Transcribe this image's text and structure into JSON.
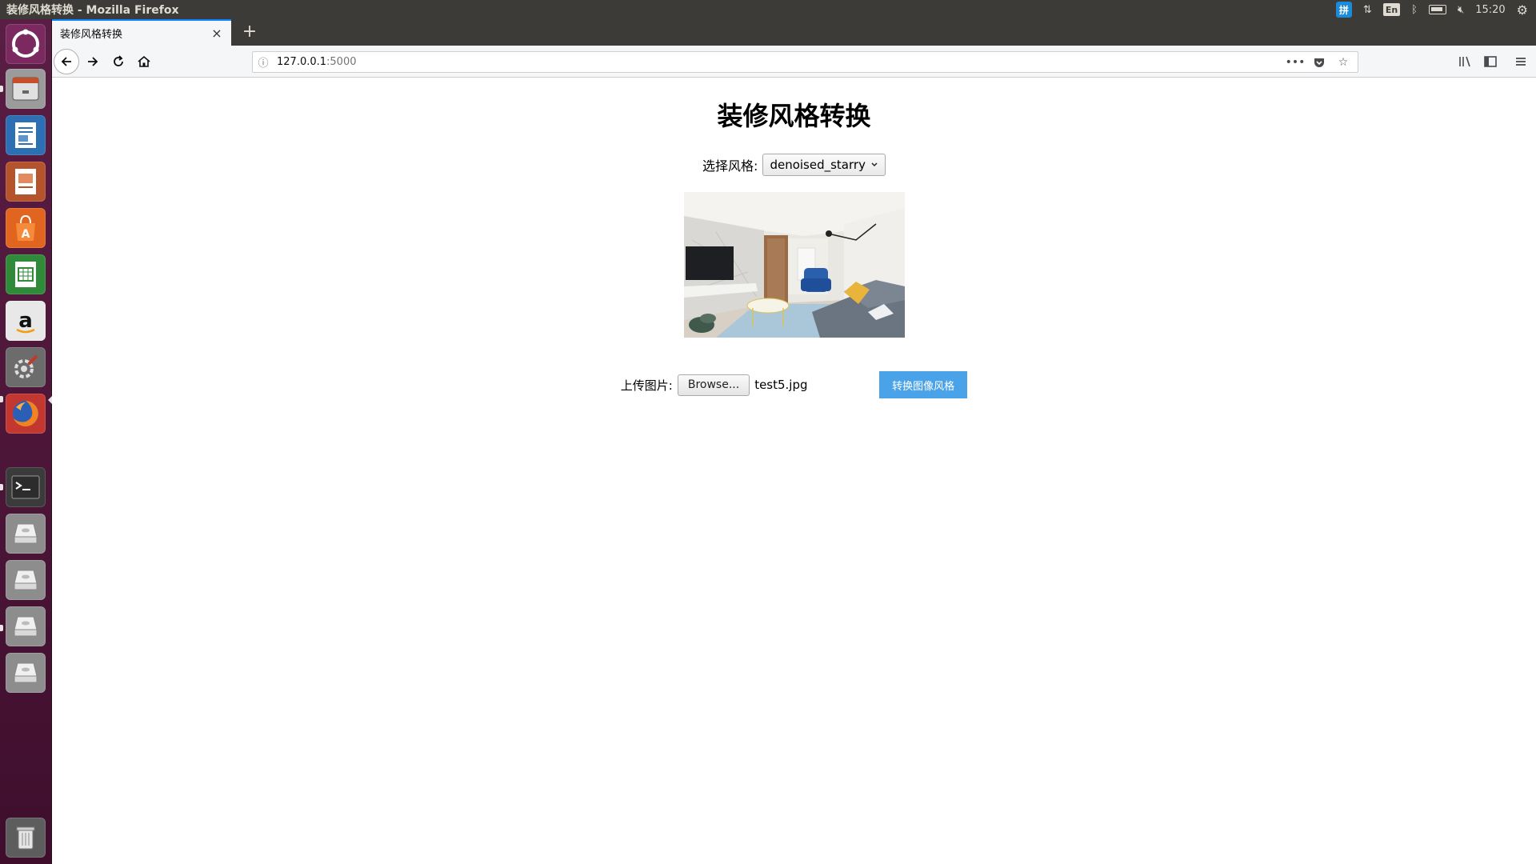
{
  "window": {
    "title": "装修风格转换 - Mozilla Firefox"
  },
  "tray": {
    "keyboard_label": "拼",
    "lang": "En",
    "time": "15:20"
  },
  "launcher": {
    "items": [
      {
        "name": "ubuntu-dash"
      },
      {
        "name": "files"
      },
      {
        "name": "libreoffice-writer"
      },
      {
        "name": "libreoffice-impress"
      },
      {
        "name": "software-center"
      },
      {
        "name": "libreoffice-calc"
      },
      {
        "name": "amazon"
      },
      {
        "name": "system-settings"
      },
      {
        "name": "firefox"
      },
      {
        "name": "terminal"
      },
      {
        "name": "drive-1"
      },
      {
        "name": "drive-2"
      },
      {
        "name": "drive-3"
      },
      {
        "name": "drive-4"
      },
      {
        "name": "trash"
      }
    ]
  },
  "browser": {
    "tab_title": "装修风格转换",
    "url_host": "127.0.0.1",
    "url_port": ":5000"
  },
  "page": {
    "title": "装修风格转换",
    "style_label": "选择风格:",
    "style_selected": "denoised_starry",
    "upload_label": "上传图片:",
    "browse_label": "Browse...",
    "file_name": "test5.jpg",
    "convert_label": "转换图像风格"
  },
  "colors": {
    "accent": "#0a84ff",
    "launcher_bg": "#4a1537",
    "convert_button": "#4aa3e8",
    "system_bar": "#3c3b37"
  }
}
